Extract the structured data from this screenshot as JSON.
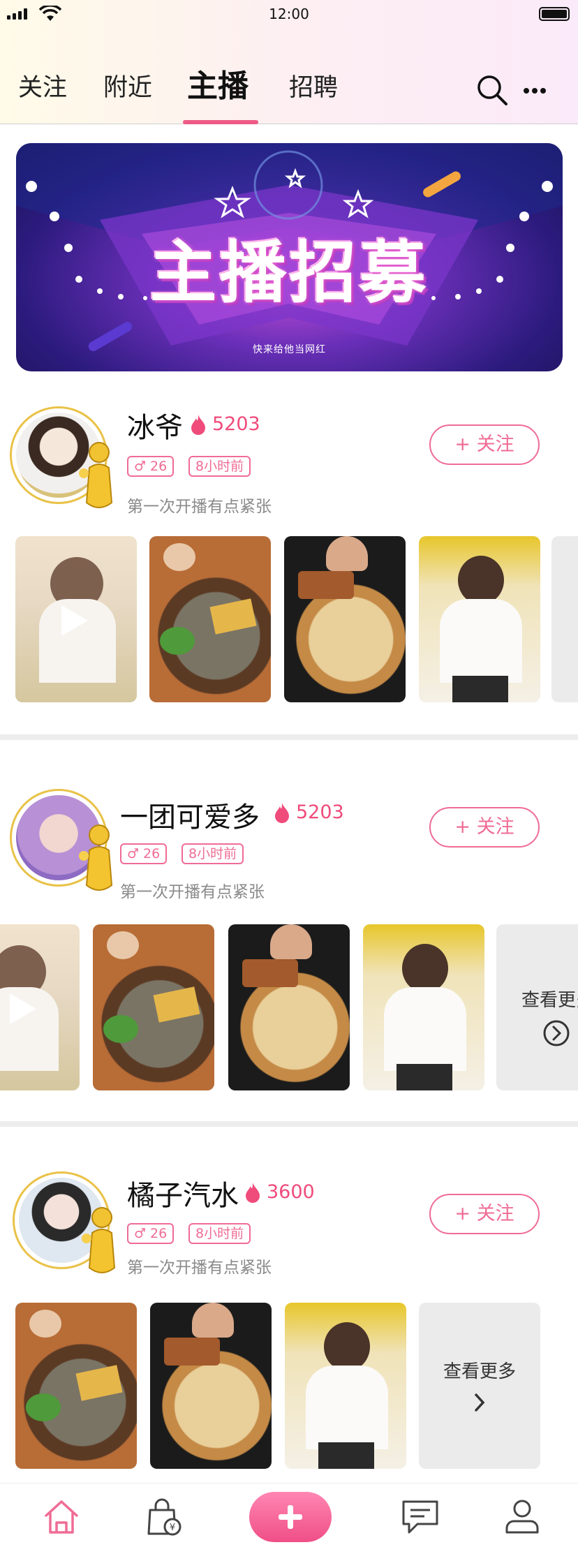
{
  "status_bar": {
    "time": "12:00"
  },
  "header": {
    "tabs": [
      {
        "label": "关注"
      },
      {
        "label": "附近"
      },
      {
        "label": "主播"
      },
      {
        "label": "招聘"
      }
    ],
    "active_tab": "主播",
    "icons": [
      "search-icon",
      "more-icon"
    ]
  },
  "banner": {
    "title": "主播招募",
    "subtitle": "快来给他当网红"
  },
  "streamers": [
    {
      "name": "冰爷",
      "heat": "5203",
      "gender_age": "26",
      "last_online": "8小时前",
      "bio": "第一次开播有点紧张",
      "follow_label": "+ 关注"
    },
    {
      "name": "一团可爱多",
      "heat": "5203",
      "gender_age": "26",
      "last_online": "8小时前",
      "bio": "第一次开播有点紧张",
      "follow_label": "+ 关注",
      "more_label": "查看更多"
    },
    {
      "name": "橘子汽水",
      "heat": "3600",
      "gender_age": "26",
      "last_online": "8小时前",
      "bio": "第一次开播有点紧张",
      "follow_label": "+ 关注",
      "more_label": "查看更多"
    }
  ],
  "bottom_nav": {
    "items": [
      "home-icon",
      "wallet-bag-icon",
      "plus-icon",
      "message-icon",
      "profile-icon"
    ],
    "accent": "#ef4f86"
  },
  "colors": {
    "accent": "#ef6c95",
    "heat": "#ef4b7b",
    "banner": "#6a2fb8"
  }
}
